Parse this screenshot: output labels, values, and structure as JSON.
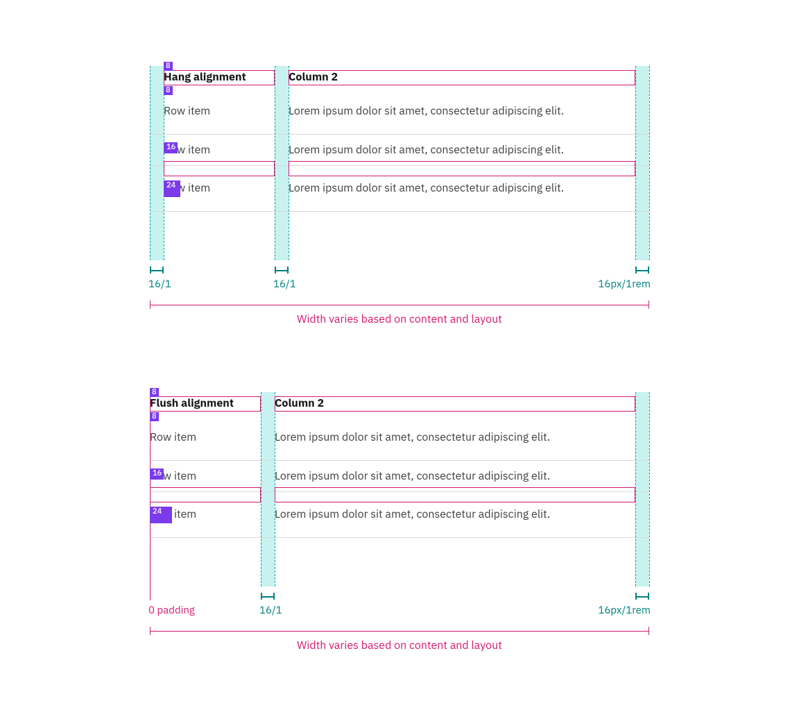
{
  "tables": {
    "hang": {
      "headers": [
        "Hang alignment",
        "Column 2"
      ],
      "rows": [
        [
          "Row item",
          "Lorem ipsum dolor sit amet, consectetur adipiscing elit."
        ],
        [
          "Row item",
          "Lorem ipsum dolor sit amet, consectetur adipiscing elit."
        ],
        [
          "Row item",
          "Lorem ipsum dolor sit amet, consectetur adipiscing elit."
        ]
      ]
    },
    "flush": {
      "headers": [
        "Flush alignment",
        "Column 2"
      ],
      "rows": [
        [
          "Row item",
          "Lorem ipsum dolor sit amet, consectetur adipiscing elit."
        ],
        [
          "Row item",
          "Lorem ipsum dolor sit amet, consectetur adipiscing elit."
        ],
        [
          "Row item",
          "Lorem ipsum dolor sit amet, consectetur adipiscing elit."
        ]
      ]
    }
  },
  "measures": {
    "px8a": "8",
    "px8b": "8",
    "px16": "16",
    "px24": "24",
    "col_gutter": "16/1",
    "right_pad": "16px/1rem",
    "zero_pad": "0 padding",
    "caption": "Width varies based on content and layout"
  }
}
